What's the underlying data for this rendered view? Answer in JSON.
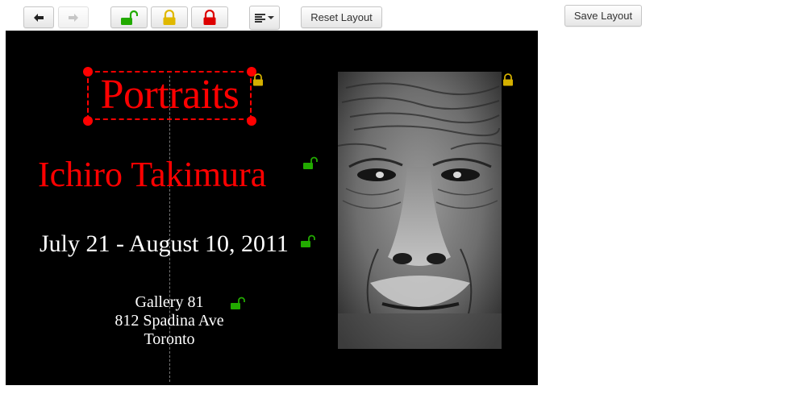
{
  "toolbar": {
    "back_icon": "arrow-left-icon",
    "forward_icon": "arrow-right-icon",
    "unlock_icon": "unlocked-padlock-icon",
    "partial_lock_icon": "padlock-icon",
    "lock_icon": "locked-padlock-icon",
    "align_icon": "align-left-icon",
    "reset_label": "Reset Layout",
    "save_label": "Save Layout",
    "colors": {
      "unlock": "#22aa00",
      "partial": "#e0b800",
      "lock": "#dd0000"
    }
  },
  "poster": {
    "background": "#000000",
    "title": "Portraits",
    "artist": "Ichiro Takimura",
    "dates": "July 21 - August 10, 2011",
    "venue": {
      "line1": "Gallery 81",
      "line2": "812 Spadina Ave",
      "line3": "Toronto"
    },
    "accent_color": "#ff0000",
    "selected_element": "title",
    "photo": "black-and-white close-up portrait of elderly man",
    "lock_states": {
      "title": "partial",
      "artist": "unlocked",
      "dates": "unlocked",
      "venue": "unlocked",
      "photo": "partial"
    }
  }
}
